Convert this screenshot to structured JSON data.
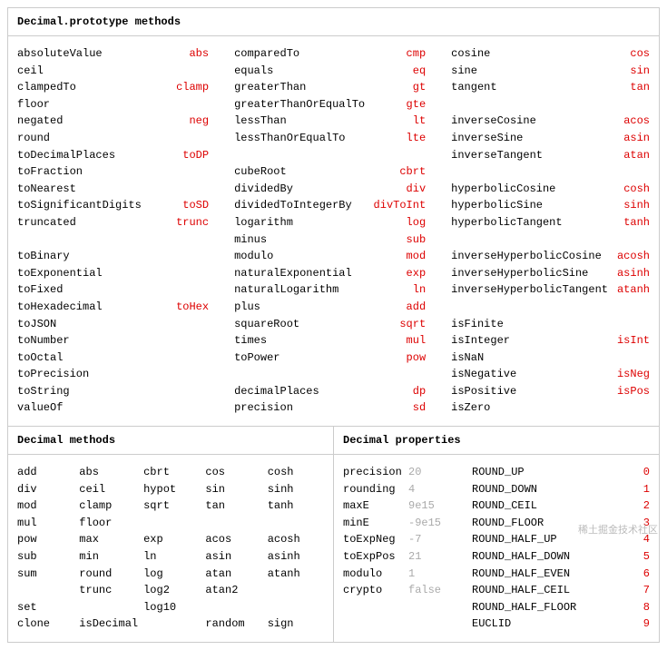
{
  "proto": {
    "title": "Decimal.prototype methods",
    "col1": [
      {
        "n": "absoluteValue",
        "a": "abs"
      },
      {
        "n": "ceil",
        "a": ""
      },
      {
        "n": "clampedTo",
        "a": "clamp"
      },
      {
        "n": "floor",
        "a": ""
      },
      {
        "n": "negated",
        "a": "neg"
      },
      {
        "n": "round",
        "a": ""
      },
      {
        "n": "toDecimalPlaces",
        "a": "toDP"
      },
      {
        "n": "toFraction",
        "a": ""
      },
      {
        "n": "toNearest",
        "a": ""
      },
      {
        "n": "toSignificantDigits",
        "a": "toSD"
      },
      {
        "n": "truncated",
        "a": "trunc"
      },
      {
        "blank": true
      },
      {
        "n": "toBinary",
        "a": ""
      },
      {
        "n": "toExponential",
        "a": ""
      },
      {
        "n": "toFixed",
        "a": ""
      },
      {
        "n": "toHexadecimal",
        "a": "toHex"
      },
      {
        "n": "toJSON",
        "a": ""
      },
      {
        "n": "toNumber",
        "a": ""
      },
      {
        "n": "toOctal",
        "a": ""
      },
      {
        "n": "toPrecision",
        "a": ""
      },
      {
        "n": "toString",
        "a": ""
      },
      {
        "n": "valueOf",
        "a": ""
      }
    ],
    "col2": [
      {
        "n": "comparedTo",
        "a": "cmp"
      },
      {
        "n": "equals",
        "a": "eq"
      },
      {
        "n": "greaterThan",
        "a": "gt"
      },
      {
        "n": "greaterThanOrEqualTo",
        "a": "gte"
      },
      {
        "n": "lessThan",
        "a": "lt"
      },
      {
        "n": "lessThanOrEqualTo",
        "a": "lte"
      },
      {
        "blank": true
      },
      {
        "n": "cubeRoot",
        "a": "cbrt"
      },
      {
        "n": "dividedBy",
        "a": "div"
      },
      {
        "n": "dividedToIntegerBy",
        "a": "divToInt"
      },
      {
        "n": "logarithm",
        "a": "log"
      },
      {
        "n": "minus",
        "a": "sub"
      },
      {
        "n": "modulo",
        "a": "mod"
      },
      {
        "n": "naturalExponential",
        "a": "exp"
      },
      {
        "n": "naturalLogarithm",
        "a": "ln"
      },
      {
        "n": "plus",
        "a": "add"
      },
      {
        "n": "squareRoot",
        "a": "sqrt"
      },
      {
        "n": "times",
        "a": "mul"
      },
      {
        "n": "toPower",
        "a": "pow"
      },
      {
        "blank": true
      },
      {
        "n": "decimalPlaces",
        "a": "dp"
      },
      {
        "n": "precision",
        "a": "sd"
      }
    ],
    "col3": [
      {
        "n": "cosine",
        "a": "cos"
      },
      {
        "n": "sine",
        "a": "sin"
      },
      {
        "n": "tangent",
        "a": "tan"
      },
      {
        "blank": true
      },
      {
        "n": "inverseCosine",
        "a": "acos"
      },
      {
        "n": "inverseSine",
        "a": "asin"
      },
      {
        "n": "inverseTangent",
        "a": "atan"
      },
      {
        "blank": true
      },
      {
        "n": "hyperbolicCosine",
        "a": "cosh"
      },
      {
        "n": "hyperbolicSine",
        "a": "sinh"
      },
      {
        "n": "hyperbolicTangent",
        "a": "tanh"
      },
      {
        "blank": true
      },
      {
        "n": "inverseHyperbolicCosine",
        "a": "acosh"
      },
      {
        "n": "inverseHyperbolicSine",
        "a": "asinh"
      },
      {
        "n": "inverseHyperbolicTangent",
        "a": "atanh"
      },
      {
        "blank": true
      },
      {
        "n": "isFinite",
        "a": ""
      },
      {
        "n": "isInteger",
        "a": "isInt"
      },
      {
        "n": "isNaN",
        "a": ""
      },
      {
        "n": "isNegative",
        "a": "isNeg"
      },
      {
        "n": "isPositive",
        "a": "isPos"
      },
      {
        "n": "isZero",
        "a": ""
      }
    ]
  },
  "methods": {
    "title": "Decimal methods",
    "rows": [
      [
        "add",
        "abs",
        "cbrt",
        "cos",
        "cosh"
      ],
      [
        "div",
        "ceil",
        "hypot",
        "sin",
        "sinh"
      ],
      [
        "mod",
        "clamp",
        "sqrt",
        "tan",
        "tanh"
      ],
      [
        "mul",
        "floor",
        "",
        "",
        ""
      ],
      [
        "pow",
        "max",
        "exp",
        "acos",
        "acosh"
      ],
      [
        "sub",
        "min",
        "ln",
        "asin",
        "asinh"
      ],
      [
        "sum",
        "round",
        "log",
        "atan",
        "atanh"
      ],
      [
        "",
        "trunc",
        "log2",
        "atan2",
        ""
      ],
      [
        "set",
        "",
        "log10",
        "",
        ""
      ],
      [
        "clone",
        "isDecimal",
        "",
        "random",
        "sign"
      ]
    ]
  },
  "props": {
    "title": "Decimal properties",
    "rows": [
      {
        "n": "precision",
        "v": "20",
        "c": "ROUND_UP",
        "i": "0"
      },
      {
        "n": "rounding",
        "v": "4",
        "c": "ROUND_DOWN",
        "i": "1"
      },
      {
        "n": "maxE",
        "v": "9e15",
        "c": "ROUND_CEIL",
        "i": "2"
      },
      {
        "n": "minE",
        "v": "-9e15",
        "c": "ROUND_FLOOR",
        "i": "3"
      },
      {
        "n": "toExpNeg",
        "v": "-7",
        "c": "ROUND_HALF_UP",
        "i": "4"
      },
      {
        "n": "toExpPos",
        "v": "21",
        "c": "ROUND_HALF_DOWN",
        "i": "5"
      },
      {
        "n": "modulo",
        "v": "1",
        "c": "ROUND_HALF_EVEN",
        "i": "6"
      },
      {
        "n": "crypto",
        "v": "false",
        "c": "ROUND_HALF_CEIL",
        "i": "7"
      },
      {
        "n": "",
        "v": "",
        "c": "ROUND_HALF_FLOOR",
        "i": "8"
      },
      {
        "n": "",
        "v": "",
        "c": "EUCLID",
        "i": "9"
      }
    ]
  },
  "watermark": "稀土掘金技术社区"
}
